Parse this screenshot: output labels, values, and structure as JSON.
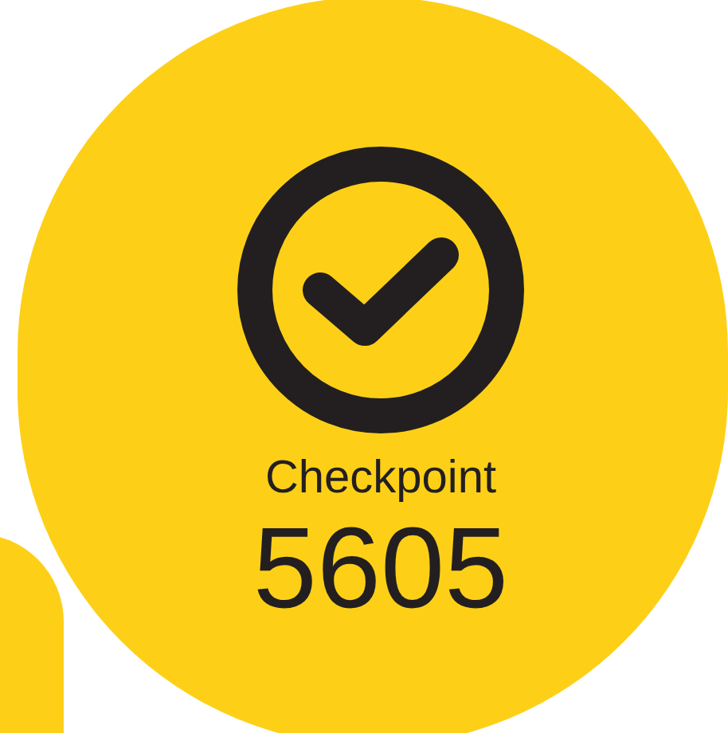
{
  "badge": {
    "label": "Checkpoint",
    "number": "5605",
    "completed": true
  }
}
